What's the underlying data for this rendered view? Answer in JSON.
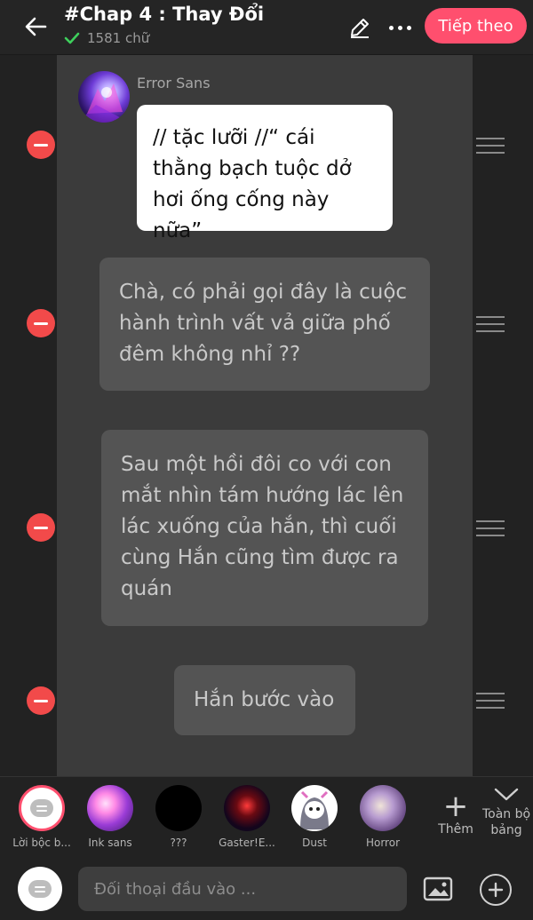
{
  "header": {
    "title": "#Chap 4 : Thay Đổi",
    "word_count": "1581 chữ",
    "next_label": "Tiếp theo",
    "icons": [
      "back-arrow-icon",
      "check-icon",
      "pencil-icon",
      "more-icon"
    ]
  },
  "messages": [
    {
      "type": "character",
      "speaker": "Error Sans",
      "text": "// tặc lưỡi //“ cái thằng bạch tuộc dở hơi ống cống này nữa”"
    },
    {
      "type": "narration",
      "text": "Chà, có phải gọi đây là cuộc hành trình vất vả giữa phố đêm không nhỉ ??"
    },
    {
      "type": "narration",
      "text": "Sau một hồi đôi co với con mắt nhìn tám hướng lác lên lác xuống của hắn, thì cuối cùng Hắn cũng tìm được ra quán"
    },
    {
      "type": "narration",
      "text": "Hắn bước vào"
    }
  ],
  "characters": [
    {
      "label": "Lời bộc b..."
    },
    {
      "label": "Ink sans"
    },
    {
      "label": "???"
    },
    {
      "label": "Gaster!E..."
    },
    {
      "label": "Dust"
    },
    {
      "label": "Horror"
    }
  ],
  "add_character_label": "Thêm",
  "full_board_label": "Toàn bộ bảng",
  "input": {
    "placeholder": "Đối thoại đầu vào ..."
  },
  "colors": {
    "accent": "#ff4f6e",
    "remove": "#f24a4a",
    "background": "#222222",
    "lane": "#3b3b3b",
    "narration_bubble": "#545454"
  }
}
